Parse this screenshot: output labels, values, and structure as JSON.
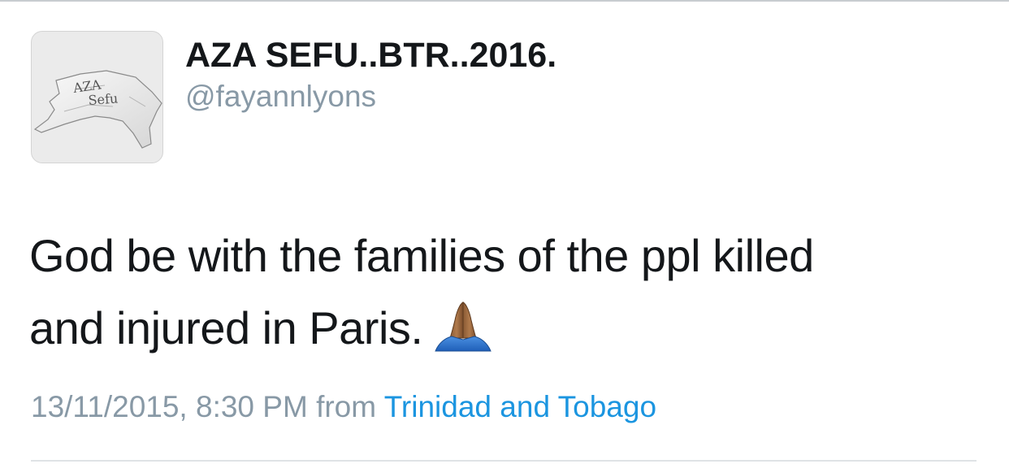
{
  "tweet": {
    "author": {
      "display_name": "AZA SEFU..BTR..2016.",
      "handle": "@fayannlyons",
      "avatar_text_line1": "AZA",
      "avatar_text_line2": "Sefu"
    },
    "text_line1": "God be with the families of the ppl killed",
    "text_line2": "and injured in Paris.",
    "emoji": "folded-hands-icon",
    "timestamp": "13/11/2015, 8:30 PM",
    "from_label": "from",
    "location": "Trinidad and Tobago"
  },
  "colors": {
    "text_primary": "#14171a",
    "text_secondary": "#8899a6",
    "link": "#1b95e0"
  }
}
